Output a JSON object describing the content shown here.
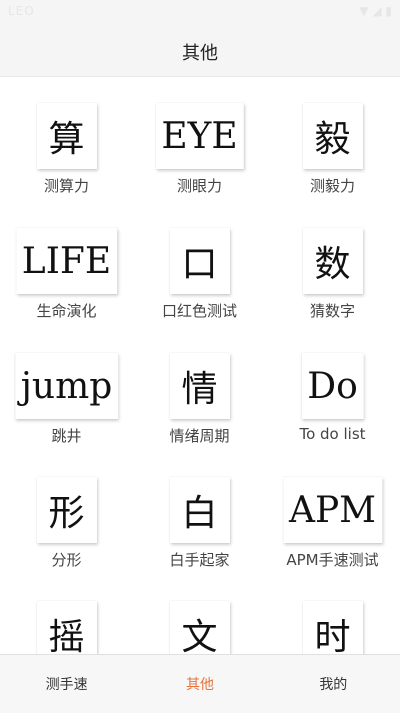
{
  "status_bar": {
    "left": "LEO",
    "right": "▼ ◢ ▮"
  },
  "title": "其他",
  "items": [
    {
      "icon": "算",
      "label": "测算力"
    },
    {
      "icon": "EYE",
      "label": "测眼力"
    },
    {
      "icon": "毅",
      "label": "测毅力"
    },
    {
      "icon": "LIFE",
      "label": "生命演化"
    },
    {
      "icon": "口",
      "label": "口红色测试"
    },
    {
      "icon": "数",
      "label": "猜数字"
    },
    {
      "icon": "jump",
      "label": "跳井"
    },
    {
      "icon": "情",
      "label": "情绪周期"
    },
    {
      "icon": "Do",
      "label": "To do list"
    },
    {
      "icon": "形",
      "label": "分形"
    },
    {
      "icon": "白",
      "label": "白手起家"
    },
    {
      "icon": "APM",
      "label": "APM手速测试"
    },
    {
      "icon": "摇",
      "label": ""
    },
    {
      "icon": "文",
      "label": ""
    },
    {
      "icon": "时",
      "label": ""
    }
  ],
  "tabs": [
    {
      "label": "测手速",
      "active": false
    },
    {
      "label": "其他",
      "active": true
    },
    {
      "label": "我的",
      "active": false
    }
  ],
  "colors": {
    "active_tab": "#e8743b"
  }
}
